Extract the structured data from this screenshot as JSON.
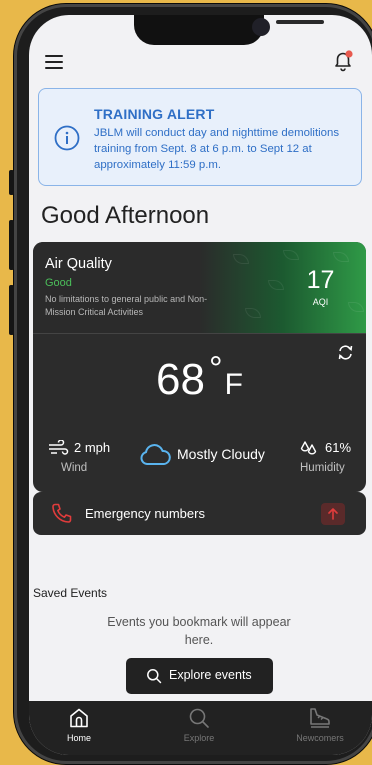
{
  "colors": {
    "alert_blue": "#2f6fc6",
    "alert_bg": "#e8f0fb",
    "card_dark": "#2c2c2c",
    "good_green": "#4bbf5a",
    "emergency_red": "#e03c3c",
    "notification_dot": "#e85a4f"
  },
  "header": {
    "menu_icon": "hamburger-menu-icon",
    "notifications_icon": "bell-icon"
  },
  "alert": {
    "icon": "info-icon",
    "title": "TRAINING ALERT",
    "message": "JBLM will conduct day and nighttime demolitions training from Sept. 8 at 6 p.m. to Sept 12 at approximately 11:59 p.m."
  },
  "greeting": "Good Afternoon",
  "air_quality": {
    "title": "Air Quality",
    "status": "Good",
    "description": "No limitations to general public and Non-Mission Critical Activities",
    "aqi_value": "17",
    "aqi_label": "AQI"
  },
  "weather": {
    "refresh_icon": "refresh-icon",
    "temperature": "68",
    "degree_symbol": "°",
    "unit": "F",
    "wind_value": "2 mph",
    "wind_label": "Wind",
    "condition": "Mostly Cloudy",
    "humidity_value": "61%",
    "humidity_label": "Humidity"
  },
  "emergency": {
    "label": "Emergency numbers",
    "icon": "phone-icon",
    "action_icon": "arrow-up-icon"
  },
  "saved_events": {
    "title": "Saved Events",
    "empty_message": "Events you bookmark will appear here.",
    "button_label": "Explore events"
  },
  "nav": {
    "items": [
      {
        "label": "Home",
        "icon": "home-icon",
        "active": true
      },
      {
        "label": "Explore",
        "icon": "search-icon",
        "active": false
      },
      {
        "label": "Newcomers",
        "icon": "shoe-icon",
        "active": false
      }
    ]
  }
}
